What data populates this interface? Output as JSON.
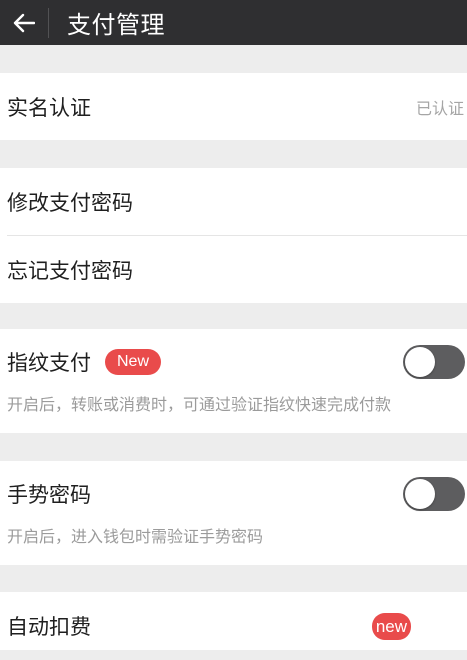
{
  "header": {
    "title": "支付管理",
    "back_icon": "arrow-left-icon"
  },
  "colors": {
    "header_bg": "#2f2f31",
    "page_bg": "#ededed",
    "badge_red": "#e94b4b",
    "toggle_off": "#5d5d5f",
    "secondary_text": "#a5a5a5"
  },
  "realname": {
    "label": "实名认证",
    "status": "已认证"
  },
  "password": {
    "change_label": "修改支付密码",
    "forgot_label": "忘记支付密码"
  },
  "fingerprint": {
    "label": "指纹支付",
    "badge": "New",
    "enabled": false,
    "description": "开启后，转账或消费时，可通过验证指纹快速完成付款"
  },
  "gesture": {
    "label": "手势密码",
    "enabled": false,
    "description": "开启后，进入钱包时需验证手势密码"
  },
  "autodeduct": {
    "label": "自动扣费",
    "badge": "new"
  }
}
